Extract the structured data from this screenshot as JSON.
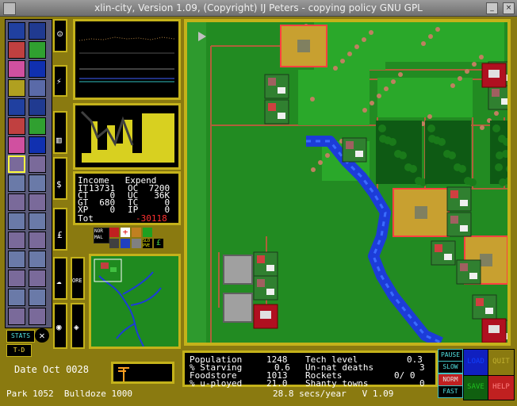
{
  "window": {
    "title": "xlin-city, Version 1.09, (Copyright) IJ Peters - copying policy GNU GPL"
  },
  "finance": {
    "col_income": "Income",
    "col_expend": "Expend",
    "rows": [
      {
        "l": "IT",
        "lv": "13731",
        "r": "OC",
        "rv": "7200"
      },
      {
        "l": "CT",
        "lv": "0",
        "r": "UC",
        "rv": "36K"
      },
      {
        "l": "GT",
        "lv": "680",
        "r": "TC",
        "rv": "0"
      },
      {
        "l": "XP",
        "lv": "0",
        "r": "IP",
        "rv": "0"
      }
    ],
    "total_label": "Tot",
    "total_value": "-30118"
  },
  "mini_screen_labels": {
    "normal": "NOR MAL",
    "ore": "ORE",
    "slo": "SLO",
    "pve": "PVE"
  },
  "date": {
    "label": "Date",
    "month": "Oct",
    "year": "0028"
  },
  "bottom_left": {
    "park_label": "Park",
    "park_cost": "1052",
    "bulldoze_label": "Bulldoze",
    "bulldoze_cost": "1000"
  },
  "stats_button": "STATS",
  "td_button": "T-D",
  "stats": {
    "population_label": "Population",
    "population": "1248",
    "starving_label": "% Starving",
    "starving": "0.6",
    "foodstore_label": "Foodstore",
    "foodstore": "1013",
    "unemployed_label": "% u-ployed",
    "unemployed": "21.0",
    "tech_label": "Tech level",
    "tech": "0.3",
    "unnat_label": "Un-nat deaths",
    "unnat": "3",
    "rockets_label": "Rockets",
    "rockets": "0/ 0",
    "shanty_label": "Shanty towns",
    "shanty": "0"
  },
  "speed": {
    "text": "28.8 secs/year",
    "version": "V 1.09"
  },
  "controls": {
    "pause": "PAUSE",
    "slow": "SLOW",
    "norm": "NORM",
    "fast": "FAST",
    "load": "LOAD",
    "quit": "QUIT",
    "save": "SAVE",
    "help": "HELP"
  },
  "colors": {
    "grass": "#228b22",
    "river": "#1c3cd8",
    "road": "#b0603a",
    "panel_border": "#c4b21a"
  }
}
